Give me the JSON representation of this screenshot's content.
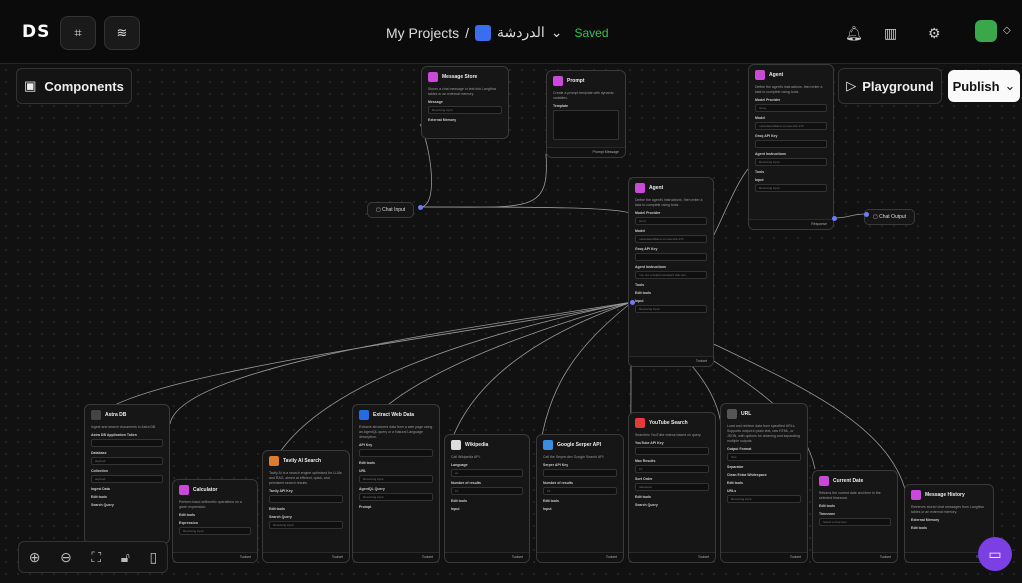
{
  "header": {
    "logo": "DS",
    "crumb_root": "My Projects",
    "crumb_sep": "/",
    "project_name": "الدردشة",
    "status": "Saved"
  },
  "toolbar": {
    "components_label": "Components",
    "playground_label": "Playground",
    "publish_label": "Publish"
  },
  "nodes": {
    "message_store": {
      "title": "Message Store",
      "desc": "Stores a chat message or text into Langflow tables or an external memory.",
      "field1": "Message",
      "field1_val": "Receiving input",
      "field2": "External Memory"
    },
    "prompt": {
      "title": "Prompt",
      "desc": "Create a prompt template with dynamic variables.",
      "field1": "Template",
      "output": "Prompt Message"
    },
    "agent_top": {
      "title": "Agent",
      "desc": "Define the agent's instructions, then enter a task to complete using tools.",
      "model_provider": "Model Provider",
      "provider_val": "Groq",
      "model": "Model",
      "model_val": "meta-llama/llama-4-maverick-17b",
      "api_key": "Groq API Key",
      "instructions": "Agent Instructions",
      "tools": "Tools",
      "input": "Input",
      "receiving": "Receiving input",
      "output": "Response"
    },
    "agent_mid": {
      "title": "Agent",
      "desc": "Define the agent's instructions, then enter a task to complete using tools.",
      "model_provider": "Model Provider",
      "provider_val": "Groq",
      "model": "Model",
      "model_val": "meta-llama/llama-4-maverick-17b",
      "api_key": "Groq API Key",
      "instructions": "Agent Instructions",
      "instructions_val": "You are a helpful assistant that can...",
      "tools": "Tools",
      "edit_tools": "Edit tools",
      "input": "Input",
      "receiving": "Receiving input",
      "output": "Toolset"
    },
    "chat_input": {
      "title": "Chat Input"
    },
    "chat_output": {
      "title": "Chat Output"
    },
    "astra": {
      "title": "Astra DB",
      "desc": "Ingest and search documents in Astra DB",
      "f1": "Astra DB Application Token",
      "f2": "Database",
      "f2_val": "skyfood",
      "f3": "Collection",
      "f3_val": "skyfood",
      "f4": "Ingest Data",
      "f5": "Edit tools",
      "f6": "Search Query",
      "output": "Toolset"
    },
    "calculator": {
      "title": "Calculator",
      "desc": "Perform basic arithmetic operations on a given expression.",
      "f1": "Edit tools",
      "f2": "Expression",
      "receiving": "Receiving input",
      "output": "Toolset"
    },
    "tavily": {
      "title": "Tavily AI Search",
      "desc": "Tavily AI is a search engine optimized for LLMs and RAG, aimed at efficient, quick, and persistent search results.",
      "f1": "Tavily API Key",
      "f2": "Edit tools",
      "f3": "Search Query",
      "receiving": "Receiving input",
      "output": "Toolset"
    },
    "extract": {
      "title": "Extract Web Data",
      "desc": "Extracts structured data from a web page using an AgentQL query or a Natural Language description.",
      "f1": "API Key",
      "f2": "Edit tools",
      "f3": "URL",
      "f4": "AgentQL Query",
      "f5": "Prompt",
      "receiving": "Receiving input",
      "output": "Toolset"
    },
    "wikipedia": {
      "title": "Wikipedia",
      "desc": "Call Wikipedia API.",
      "f1": "Language",
      "f1_val": "en",
      "f2": "Number of results",
      "f2_val": "10",
      "f3": "Edit tools",
      "f4": "Input",
      "receiving": "Receiving input",
      "output": "Toolset"
    },
    "serper": {
      "title": "Google Serper API",
      "desc": "Call the Serper.dev Google Search API.",
      "f1": "Serper API Key",
      "f2": "Number of results",
      "f2_val": "10",
      "f3": "Edit tools",
      "f4": "Input",
      "receiving": "Receiving input",
      "output": "Toolset"
    },
    "youtube": {
      "title": "YouTube Search",
      "desc": "Searches YouTube videos based on query.",
      "f1": "YouTube API Key",
      "f2": "Max Results",
      "f2_val": "10",
      "f3": "Sort Order",
      "f3_val": "relevance",
      "f4": "Edit tools",
      "f5": "Search Query",
      "receiving": "Receiving input",
      "output": "Toolset"
    },
    "url": {
      "title": "URL",
      "desc": "Load and retrieve data from specified URLs. Supports output in plain text, raw HTML, or JSON, with options for cleaning and separating multiple outputs.",
      "f1": "Output Format",
      "f1_val": "Text",
      "f2": "Separator",
      "f3": "Clean Extra Whitespace",
      "f4": "Edit tools",
      "f5": "URLs",
      "receiving": "Receiving input",
      "output": "Toolset"
    },
    "current_date": {
      "title": "Current Date",
      "desc": "Returns the current date and time in the selected timezone.",
      "f1": "Edit tools",
      "f2": "Timezone",
      "f2_val": "Select a timezone",
      "output": "Toolset"
    },
    "history": {
      "title": "Message History",
      "desc": "Retrieves stored chat messages from Langflow tables or an external memory.",
      "f1": "External Memory",
      "f2": "Edit tools",
      "output": "Toolset"
    }
  },
  "colors": {
    "accent": "#c94ad8",
    "saved": "#2ec84e",
    "handle": "#6b7cff",
    "chat_bubble": "#7b3fe4"
  }
}
